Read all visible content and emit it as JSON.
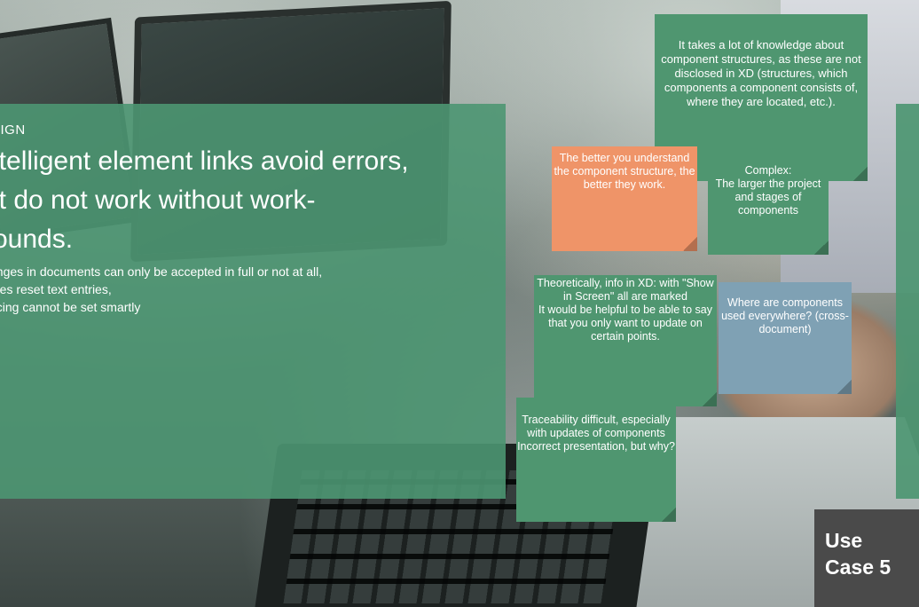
{
  "slide": {
    "eyebrow": "SIGN",
    "headline_lines": [
      "ntelligent element links avoid errors,",
      "ut do not work without work-",
      "rounds."
    ],
    "bullets": [
      "anges in documents can only be accepted in full or not at all,",
      "utes reset text entries,",
      "acing cannot be set smartly"
    ]
  },
  "notes": {
    "knowledge": "It takes a lot of knowledge about component structures, as these are not disclosed in XD (structures, which components a component consists of, where they are located, etc.).",
    "better": "The better you understand the component structure, the better they work.",
    "complex": "Complex:\nThe larger the project and stages of components",
    "theoretically": "Theoretically, info in XD: with \"Show in Screen\" all are marked\nIt would be helpful to be able to say that you only want to update on certain points.",
    "where": "Where are components used everywhere? (cross-document)",
    "trace": "Traceability difficult, especially with updates of components\nIncorrect presentation, but why?"
  },
  "usecase": {
    "line1": "Use",
    "line2": "Case 5"
  },
  "colors": {
    "panel_green": "#4d9672",
    "note_green": "#4f9670",
    "note_orange": "#ef9468",
    "note_blue": "#7fa1b4",
    "badge_gray": "#4a4a4a"
  }
}
